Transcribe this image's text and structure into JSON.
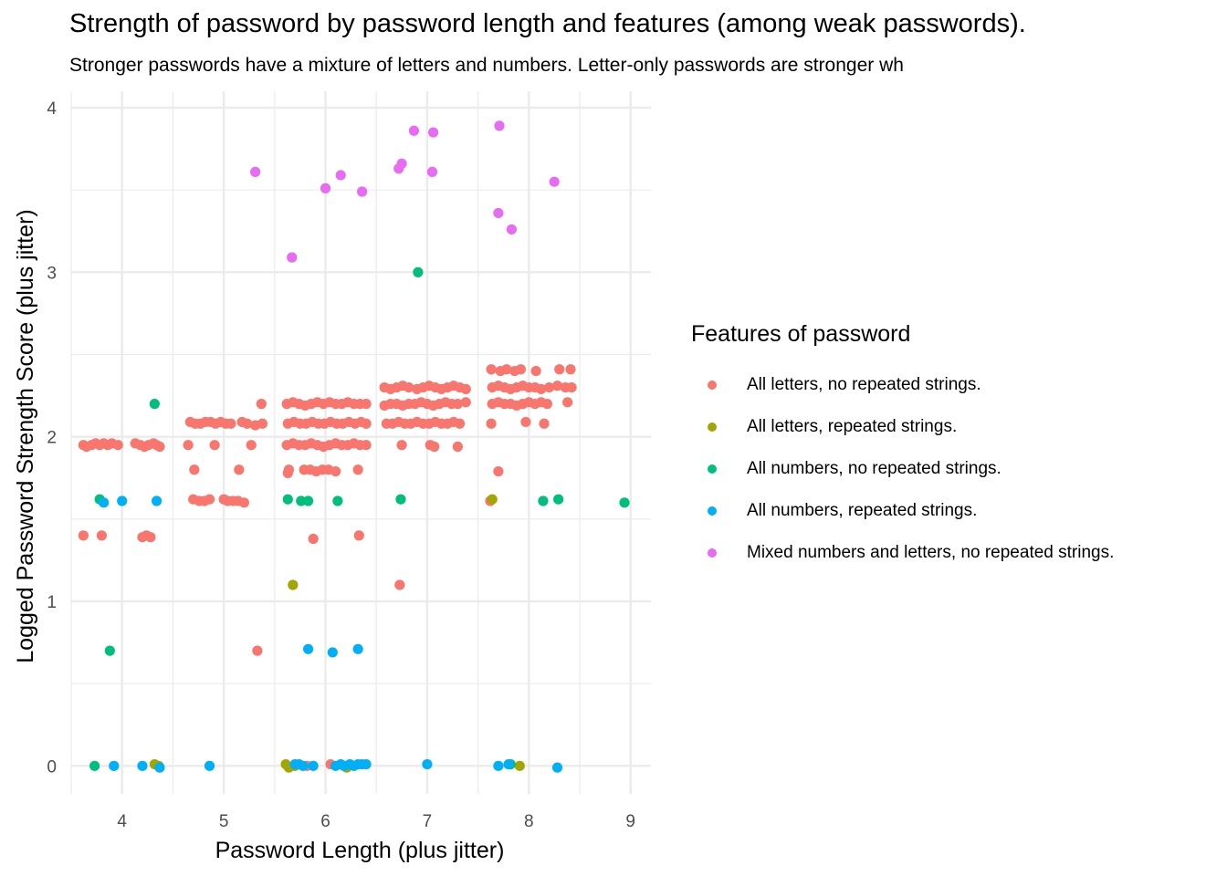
{
  "chart_data": {
    "type": "scatter",
    "title": "Strength of password by password length and features (among weak passwords).",
    "subtitle": "Stronger passwords have a mixture of letters and numbers. Letter-only passwords are stronger wh",
    "xlabel": "Password Length (plus jitter)",
    "ylabel": "Logged Password Strength Score (plus jitter)",
    "xlim": [
      3.5,
      9.2
    ],
    "ylim": [
      -0.17,
      4.1
    ],
    "xticks": [
      4,
      5,
      6,
      7,
      8,
      9
    ],
    "yticks": [
      0,
      1,
      2,
      3,
      4
    ],
    "grid": true,
    "legend_title": "Features of password",
    "legend_position": "right",
    "series": [
      {
        "name": "All letters, no repeated strings.",
        "color": "#F8766D",
        "points": [
          [
            3.62,
            1.95
          ],
          [
            3.65,
            1.94
          ],
          [
            3.7,
            1.95
          ],
          [
            3.74,
            1.96
          ],
          [
            3.78,
            1.95
          ],
          [
            3.82,
            1.96
          ],
          [
            3.86,
            1.95
          ],
          [
            3.9,
            1.96
          ],
          [
            3.96,
            1.95
          ],
          [
            4.13,
            1.96
          ],
          [
            4.18,
            1.95
          ],
          [
            4.22,
            1.94
          ],
          [
            4.26,
            1.95
          ],
          [
            4.31,
            1.96
          ],
          [
            4.34,
            1.95
          ],
          [
            4.37,
            1.94
          ],
          [
            3.62,
            1.4
          ],
          [
            3.8,
            1.4
          ],
          [
            4.2,
            1.39
          ],
          [
            4.24,
            1.4
          ],
          [
            4.28,
            1.39
          ],
          [
            4.67,
            2.09
          ],
          [
            4.72,
            2.08
          ],
          [
            4.77,
            2.08
          ],
          [
            4.82,
            2.09
          ],
          [
            4.87,
            2.09
          ],
          [
            4.92,
            2.08
          ],
          [
            4.97,
            2.09
          ],
          [
            5.02,
            2.08
          ],
          [
            5.07,
            2.08
          ],
          [
            5.18,
            2.09
          ],
          [
            5.23,
            2.08
          ],
          [
            5.31,
            2.07
          ],
          [
            5.38,
            2.08
          ],
          [
            4.65,
            1.95
          ],
          [
            4.91,
            1.95
          ],
          [
            5.27,
            1.95
          ],
          [
            4.71,
            1.8
          ],
          [
            5.15,
            1.8
          ],
          [
            4.7,
            1.62
          ],
          [
            4.76,
            1.61
          ],
          [
            4.81,
            1.61
          ],
          [
            4.86,
            1.62
          ],
          [
            5.0,
            1.62
          ],
          [
            5.04,
            1.61
          ],
          [
            5.09,
            1.61
          ],
          [
            5.14,
            1.61
          ],
          [
            5.2,
            1.6
          ],
          [
            5.37,
            2.2
          ],
          [
            5.33,
            0.7
          ],
          [
            5.88,
            1.38
          ],
          [
            6.33,
            1.4
          ],
          [
            5.62,
            2.2
          ],
          [
            5.68,
            2.21
          ],
          [
            5.74,
            2.2
          ],
          [
            5.8,
            2.19
          ],
          [
            5.86,
            2.2
          ],
          [
            5.92,
            2.21
          ],
          [
            5.98,
            2.2
          ],
          [
            6.04,
            2.21
          ],
          [
            6.1,
            2.2
          ],
          [
            6.16,
            2.2
          ],
          [
            6.22,
            2.21
          ],
          [
            6.28,
            2.2
          ],
          [
            6.34,
            2.2
          ],
          [
            6.4,
            2.2
          ],
          [
            5.63,
            2.08
          ],
          [
            5.69,
            2.09
          ],
          [
            5.75,
            2.08
          ],
          [
            5.81,
            2.08
          ],
          [
            5.87,
            2.09
          ],
          [
            5.93,
            2.08
          ],
          [
            5.99,
            2.08
          ],
          [
            6.05,
            2.09
          ],
          [
            6.11,
            2.08
          ],
          [
            6.17,
            2.08
          ],
          [
            6.23,
            2.09
          ],
          [
            6.29,
            2.08
          ],
          [
            6.35,
            2.09
          ],
          [
            6.4,
            2.08
          ],
          [
            5.62,
            1.95
          ],
          [
            5.68,
            1.96
          ],
          [
            5.74,
            1.95
          ],
          [
            5.8,
            1.95
          ],
          [
            5.86,
            1.96
          ],
          [
            5.92,
            1.95
          ],
          [
            5.98,
            1.94
          ],
          [
            6.04,
            1.95
          ],
          [
            6.1,
            1.96
          ],
          [
            6.16,
            1.95
          ],
          [
            6.22,
            1.95
          ],
          [
            6.28,
            1.96
          ],
          [
            6.34,
            1.95
          ],
          [
            6.4,
            1.95
          ],
          [
            5.64,
            1.8
          ],
          [
            5.79,
            1.8
          ],
          [
            5.85,
            1.8
          ],
          [
            5.91,
            1.79
          ],
          [
            5.97,
            1.8
          ],
          [
            6.03,
            1.8
          ],
          [
            6.1,
            1.79
          ],
          [
            6.32,
            1.8
          ],
          [
            5.63,
            1.78
          ],
          [
            5.82,
            0.0
          ],
          [
            6.05,
            0.01
          ],
          [
            6.2,
            0.0
          ],
          [
            6.58,
            2.3
          ],
          [
            6.64,
            2.29
          ],
          [
            6.7,
            2.3
          ],
          [
            6.76,
            2.31
          ],
          [
            6.82,
            2.3
          ],
          [
            6.9,
            2.29
          ],
          [
            6.96,
            2.3
          ],
          [
            7.02,
            2.31
          ],
          [
            7.08,
            2.3
          ],
          [
            7.14,
            2.29
          ],
          [
            7.2,
            2.3
          ],
          [
            7.26,
            2.31
          ],
          [
            7.32,
            2.3
          ],
          [
            7.38,
            2.29
          ],
          [
            6.58,
            2.19
          ],
          [
            6.64,
            2.2
          ],
          [
            6.7,
            2.2
          ],
          [
            6.76,
            2.19
          ],
          [
            6.82,
            2.2
          ],
          [
            6.88,
            2.2
          ],
          [
            6.94,
            2.21
          ],
          [
            7.0,
            2.2
          ],
          [
            7.06,
            2.19
          ],
          [
            7.12,
            2.2
          ],
          [
            7.18,
            2.21
          ],
          [
            7.24,
            2.2
          ],
          [
            7.3,
            2.2
          ],
          [
            7.38,
            2.21
          ],
          [
            6.6,
            2.08
          ],
          [
            6.66,
            2.08
          ],
          [
            6.72,
            2.09
          ],
          [
            6.78,
            2.08
          ],
          [
            6.84,
            2.08
          ],
          [
            6.9,
            2.09
          ],
          [
            6.96,
            2.08
          ],
          [
            7.02,
            2.08
          ],
          [
            7.08,
            2.09
          ],
          [
            7.14,
            2.08
          ],
          [
            7.2,
            2.08
          ],
          [
            7.26,
            2.09
          ],
          [
            7.32,
            2.08
          ],
          [
            6.75,
            1.95
          ],
          [
            7.03,
            1.95
          ],
          [
            7.07,
            1.94
          ],
          [
            7.3,
            1.94
          ],
          [
            6.73,
            1.1
          ],
          [
            7.63,
            2.41
          ],
          [
            7.72,
            2.4
          ],
          [
            7.78,
            2.41
          ],
          [
            7.86,
            2.4
          ],
          [
            7.92,
            2.41
          ],
          [
            8.07,
            2.4
          ],
          [
            8.3,
            2.41
          ],
          [
            8.41,
            2.41
          ],
          [
            7.64,
            2.3
          ],
          [
            7.7,
            2.31
          ],
          [
            7.76,
            2.3
          ],
          [
            7.82,
            2.29
          ],
          [
            7.88,
            2.3
          ],
          [
            7.94,
            2.31
          ],
          [
            8.0,
            2.3
          ],
          [
            8.06,
            2.3
          ],
          [
            8.12,
            2.29
          ],
          [
            8.2,
            2.3
          ],
          [
            8.28,
            2.31
          ],
          [
            8.36,
            2.3
          ],
          [
            8.42,
            2.3
          ],
          [
            7.64,
            2.2
          ],
          [
            7.7,
            2.21
          ],
          [
            7.76,
            2.2
          ],
          [
            7.82,
            2.2
          ],
          [
            7.88,
            2.19
          ],
          [
            7.94,
            2.2
          ],
          [
            8.0,
            2.21
          ],
          [
            8.06,
            2.2
          ],
          [
            8.12,
            2.21
          ],
          [
            8.18,
            2.2
          ],
          [
            8.38,
            2.21
          ],
          [
            7.63,
            2.08
          ],
          [
            7.97,
            2.09
          ],
          [
            8.15,
            2.08
          ],
          [
            7.7,
            1.79
          ],
          [
            7.62,
            1.61
          ]
        ]
      },
      {
        "name": "All letters, repeated strings.",
        "color": "#A3A500",
        "points": [
          [
            4.32,
            0.01
          ],
          [
            4.36,
            0.0
          ],
          [
            5.61,
            0.01
          ],
          [
            5.64,
            -0.01
          ],
          [
            5.7,
            0.0
          ],
          [
            5.68,
            1.1
          ],
          [
            6.21,
            -0.01
          ],
          [
            7.64,
            1.62
          ],
          [
            7.91,
            0.0
          ]
        ]
      },
      {
        "name": "All numbers, no repeated strings.",
        "color": "#00BF7D",
        "points": [
          [
            3.78,
            1.62
          ],
          [
            4.32,
            2.2
          ],
          [
            3.88,
            0.7
          ],
          [
            3.73,
            0.0
          ],
          [
            5.63,
            1.62
          ],
          [
            5.76,
            1.61
          ],
          [
            5.83,
            1.61
          ],
          [
            6.12,
            1.61
          ],
          [
            6.74,
            1.62
          ],
          [
            6.91,
            3.0
          ],
          [
            7.82,
            0.01
          ],
          [
            8.14,
            1.61
          ],
          [
            8.29,
            1.62
          ],
          [
            8.94,
            1.6
          ]
        ]
      },
      {
        "name": "All numbers, repeated strings.",
        "color": "#00B0F6",
        "points": [
          [
            3.82,
            1.6
          ],
          [
            4.0,
            1.61
          ],
          [
            4.34,
            1.61
          ],
          [
            3.92,
            0.0
          ],
          [
            4.2,
            0.0
          ],
          [
            4.37,
            -0.01
          ],
          [
            4.86,
            0.0
          ],
          [
            5.7,
            0.01
          ],
          [
            5.74,
            0.01
          ],
          [
            5.78,
            0.0
          ],
          [
            5.88,
            0.0
          ],
          [
            5.83,
            0.71
          ],
          [
            6.07,
            0.69
          ],
          [
            6.32,
            0.71
          ],
          [
            6.1,
            0.0
          ],
          [
            6.15,
            0.01
          ],
          [
            6.18,
            0.0
          ],
          [
            6.24,
            0.01
          ],
          [
            6.28,
            0.0
          ],
          [
            6.32,
            0.01
          ],
          [
            6.36,
            0.01
          ],
          [
            6.4,
            0.01
          ],
          [
            7.0,
            0.01
          ],
          [
            7.7,
            0.0
          ],
          [
            7.8,
            0.01
          ],
          [
            8.28,
            -0.01
          ]
        ]
      },
      {
        "name": "Mixed numbers and letters, no repeated strings.",
        "color": "#E76BF3",
        "points": [
          [
            5.31,
            3.61
          ],
          [
            5.67,
            3.09
          ],
          [
            6.0,
            3.51
          ],
          [
            6.15,
            3.59
          ],
          [
            6.36,
            3.49
          ],
          [
            6.72,
            3.63
          ],
          [
            6.75,
            3.66
          ],
          [
            6.87,
            3.86
          ],
          [
            7.05,
            3.61
          ],
          [
            7.06,
            3.85
          ],
          [
            7.71,
            3.89
          ],
          [
            7.7,
            3.36
          ],
          [
            7.83,
            3.26
          ],
          [
            8.25,
            3.55
          ]
        ]
      }
    ]
  }
}
